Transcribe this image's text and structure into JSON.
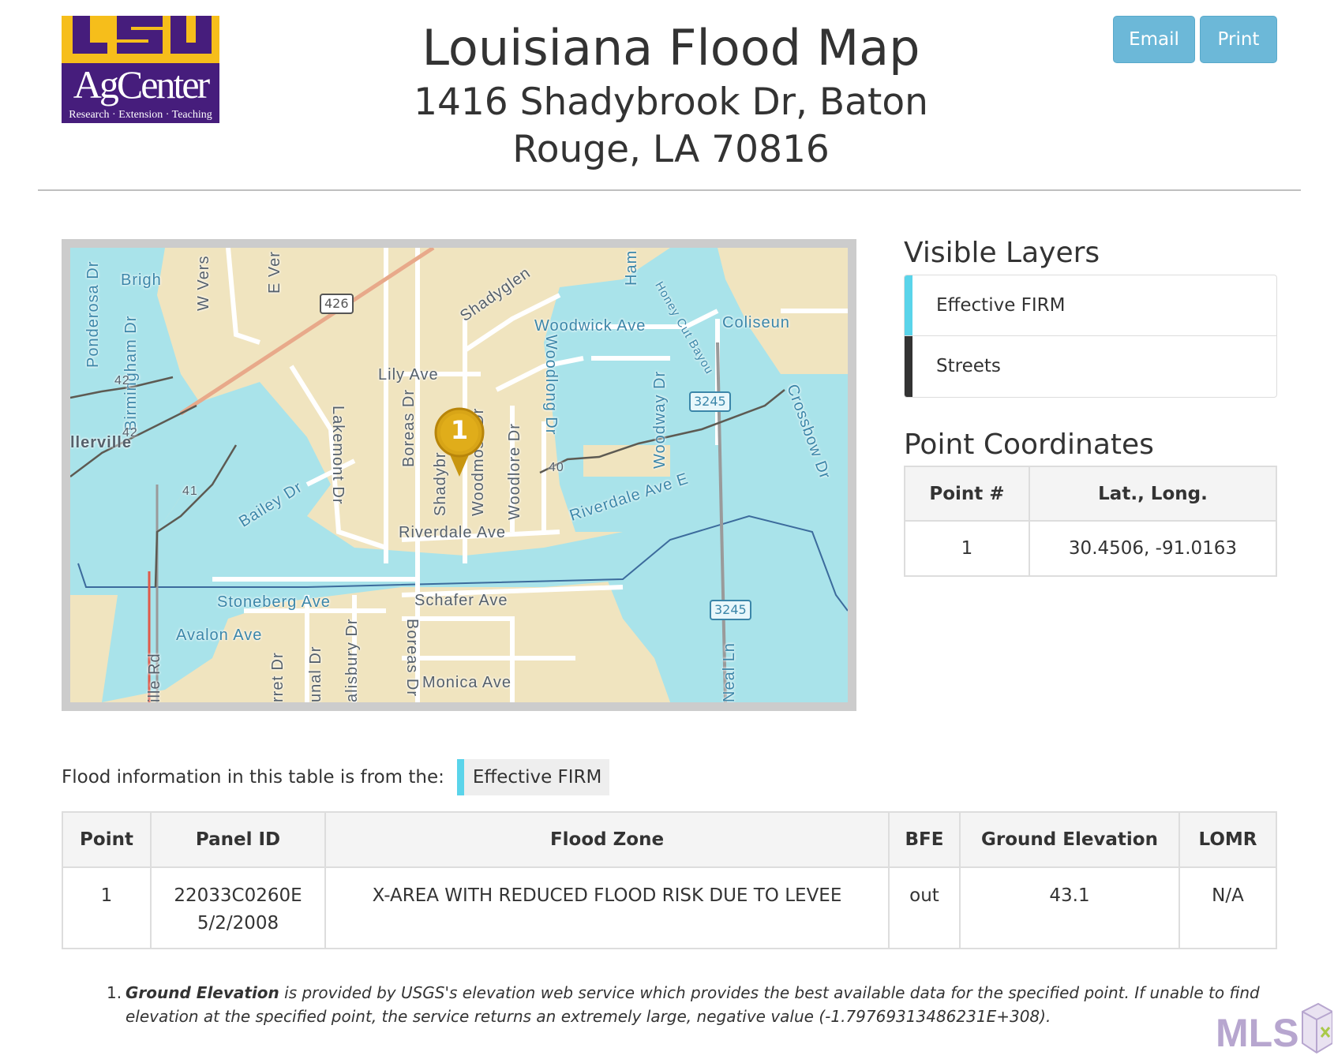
{
  "header": {
    "logo": {
      "top_text": "LSU",
      "mid_text": "AgCenter",
      "tagline": "Research · Extension · Teaching"
    },
    "title": "Louisiana Flood Map",
    "address_line1": "1416 Shadybrook Dr, Baton",
    "address_line2": "Rouge, LA 70816",
    "email_label": "Email",
    "print_label": "Print"
  },
  "map": {
    "marker_label": "1",
    "labels": {
      "ponderosa": "Ponderosa Dr",
      "brigh": "Brigh",
      "birmingham": "Birmingham Dr",
      "wvers": "W Vers",
      "ever": "E Ver",
      "shadyglen": "Shadyglen",
      "woodwick": "Woodwick Ave",
      "ham": "Ham",
      "coliseum": "Coliseun",
      "honeycut": "Honey Cut Bayou",
      "lily": "Lily Ave",
      "lakemont": "Lakemont Dr",
      "boreas_top": "Boreas Dr",
      "shadybrook": "Shadybr",
      "woodmoss": "Woodmoss Dr",
      "woodlore": "Woodlore Dr",
      "woodlong": "Woodlong Dr",
      "woodway": "Woodway Dr",
      "crossbow": "Crossbow Dr",
      "millerville": "llerville",
      "bailey": "Bailey Dr",
      "riverdale": "Riverdale Ave",
      "riverdale_e": "Riverdale Ave E",
      "stoneberg": "Stoneberg Ave",
      "schafer": "Schafer Ave",
      "avalon": "Avalon Ave",
      "ville": "ille Rd",
      "rret": "rret Dr",
      "unal": "unal Dr",
      "salisbury": "alisbury Dr",
      "boreas_bottom": "Boreas Dr",
      "monica": "Monica Ave",
      "neal": "Neal Ln",
      "c42a": "42",
      "c42b": "42",
      "c41": "41",
      "c40": "40",
      "shield_426": "426",
      "shield_3245a": "3245",
      "shield_3245b": "3245"
    },
    "colors": {
      "land": "#f0e4bf",
      "flood": "#a9e3ea",
      "road": "#ffffff",
      "highway": "#e8a98a"
    }
  },
  "visible_layers": {
    "heading": "Visible Layers",
    "items": [
      {
        "label": "Effective FIRM",
        "color": "#5ad4ea"
      },
      {
        "label": "Streets",
        "color": "#333333"
      }
    ]
  },
  "point_coordinates": {
    "heading": "Point Coordinates",
    "columns": [
      "Point #",
      "Lat., Long."
    ],
    "rows": [
      {
        "point": "1",
        "latlong": "30.4506, -91.0163"
      }
    ]
  },
  "source": {
    "text": "Flood information in this table is from the:",
    "badge": "Effective FIRM"
  },
  "flood_table": {
    "columns": [
      "Point",
      "Panel ID",
      "Flood Zone",
      "BFE",
      "Ground Elevation",
      "LOMR"
    ],
    "rows": [
      {
        "point": "1",
        "panel_id": "22033C0260E",
        "panel_date": "5/2/2008",
        "flood_zone": "X-AREA WITH REDUCED FLOOD RISK DUE TO LEVEE",
        "bfe": "out",
        "ground_elevation": "43.1",
        "lomr": "N/A"
      }
    ]
  },
  "footnote": {
    "number": "1.",
    "term": "Ground Elevation",
    "text": " is provided by USGS's elevation web service which provides the best available data for the specified point. If unable to find elevation at the specified point, the service returns an extremely large, negative value (-1.79769313486231E+308)."
  },
  "watermark": {
    "text": "MLS"
  }
}
